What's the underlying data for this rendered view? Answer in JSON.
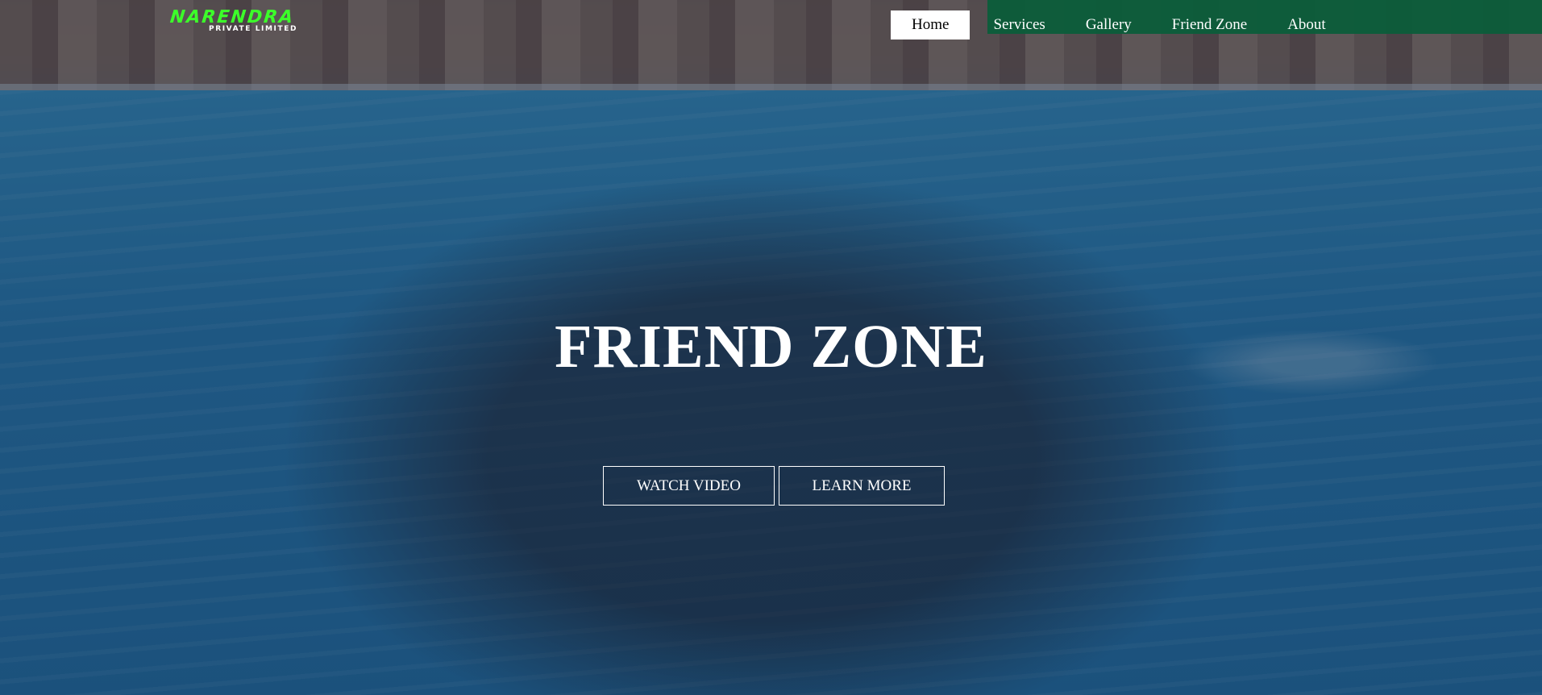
{
  "brand": {
    "name": "NARENDRA",
    "tagline": "PRIVATE LIMITED",
    "color": "#3cff2a"
  },
  "nav": {
    "items": [
      {
        "label": "Home",
        "active": true
      },
      {
        "label": "Services",
        "active": false
      },
      {
        "label": "Gallery",
        "active": false
      },
      {
        "label": "Friend Zone",
        "active": false
      },
      {
        "label": "About",
        "active": false
      }
    ]
  },
  "hero": {
    "title": "FRIEND ZONE",
    "background": "group-photo-wave-pool",
    "buttons": {
      "watch_video": "WATCH VIDEO",
      "learn_more": "LEARN MORE"
    }
  },
  "colors": {
    "nav_band": "#0b5d3a",
    "active_tab_bg": "#ffffff",
    "text": "#ffffff"
  }
}
